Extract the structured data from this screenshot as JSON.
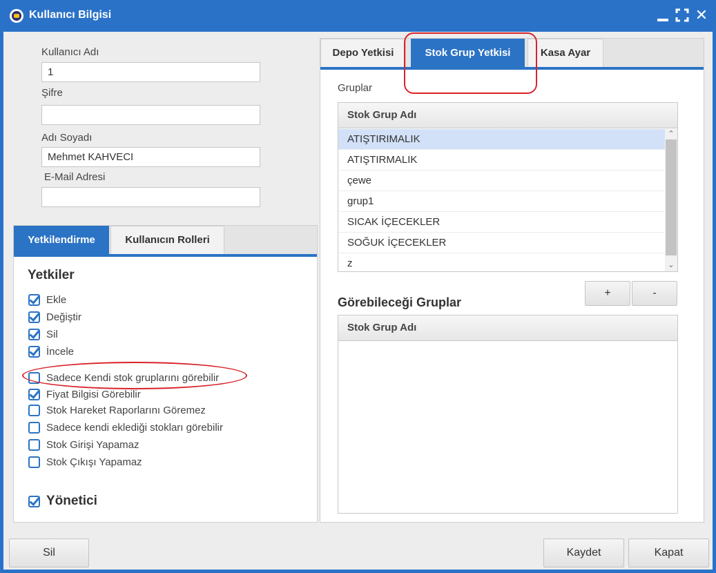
{
  "window": {
    "title": "Kullanıcı Bilgisi",
    "controls": {
      "minimize": "—",
      "maximize": "⛶",
      "close": "✕"
    }
  },
  "user_form": {
    "username_label": "Kullanıcı Adı",
    "username_value": "1",
    "password_label": "Şifre",
    "password_value": "",
    "fullname_label": "Adı Soyadı",
    "fullname_value": "Mehmet KAHVECI",
    "email_label": "E-Mail Adresi",
    "email_value": ""
  },
  "left_tabs": [
    {
      "label": "Yetkilendirme",
      "active": true
    },
    {
      "label": "Kullanıcın Rolleri",
      "active": false
    }
  ],
  "permissions": {
    "title": "Yetkiler",
    "items": [
      {
        "label": "Ekle",
        "checked": true
      },
      {
        "label": "Değiştir",
        "checked": true
      },
      {
        "label": "Sil",
        "checked": true
      },
      {
        "label": "İncele",
        "checked": true
      },
      {
        "label": "Sadece Kendi stok gruplarını görebilir",
        "checked": false
      },
      {
        "label": "Fiyat Bilgisi Görebilir",
        "checked": true
      },
      {
        "label": "Stok Hareket Raporlarını Göremez",
        "checked": false
      },
      {
        "label": "Sadece kendi eklediği stokları görebilir",
        "checked": false
      },
      {
        "label": "Stok Girişi Yapamaz",
        "checked": false
      },
      {
        "label": "Stok Çıkışı Yapamaz",
        "checked": false
      }
    ],
    "admin_label": "Yönetici",
    "admin_checked": true
  },
  "right_tabs": [
    {
      "label": "Depo Yetkisi",
      "active": false
    },
    {
      "label": "Stok Grup Yetkisi",
      "active": true
    },
    {
      "label": "Kasa Ayar",
      "active": false
    }
  ],
  "groups": {
    "label": "Gruplar",
    "column_header": "Stok Grup Adı",
    "rows": [
      "ATIŞTIRIMALIK",
      "ATIŞTIRMALIK",
      "çewe",
      "grup1",
      "SICAK İÇECEKLER",
      "SOĞUK İÇECEKLER",
      "z"
    ],
    "selected_index": 0
  },
  "visible_groups": {
    "title": "Görebileceği Gruplar",
    "column_header": "Stok Grup Adı",
    "rows": []
  },
  "buttons": {
    "add": "+",
    "remove": "-",
    "delete": "Sil",
    "save": "Kaydet",
    "close": "Kapat"
  },
  "colors": {
    "accent": "#2b73c5",
    "annotation": "#d8232a"
  }
}
